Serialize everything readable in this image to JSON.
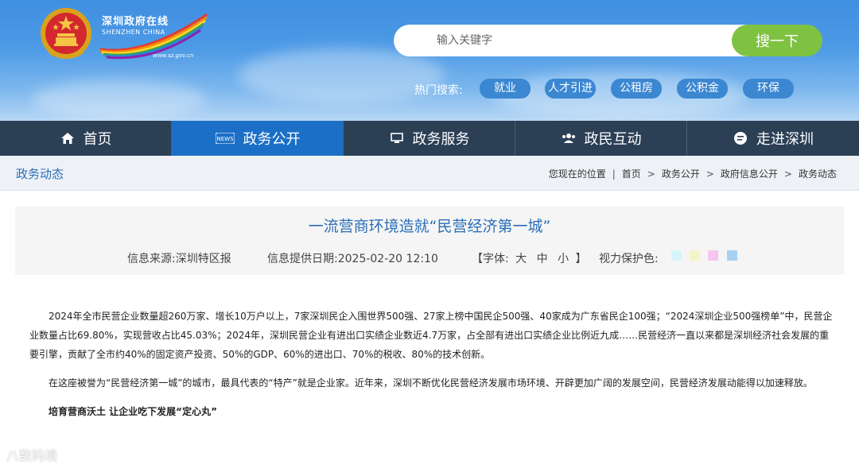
{
  "header": {
    "logo_cn": "深圳政府在线",
    "logo_en": "SHENZHEN CHINA",
    "logo_url": "www.sz.gov.cn",
    "search_placeholder": "输入关键字",
    "search_button": "搜一下",
    "hot_label": "热门搜索:",
    "hot_tags": [
      "就业",
      "人才引进",
      "公租房",
      "公积金",
      "环保"
    ]
  },
  "nav": {
    "items": [
      {
        "label": "首页",
        "icon": "home-icon"
      },
      {
        "label": "政务公开",
        "icon": "news-icon"
      },
      {
        "label": "政务服务",
        "icon": "monitor-icon"
      },
      {
        "label": "政民互动",
        "icon": "people-icon"
      },
      {
        "label": "走进深圳",
        "icon": "chat-icon"
      }
    ],
    "active_index": 1
  },
  "breadcrumb": {
    "section_title": "政务动态",
    "items": [
      "您现在的位置",
      "首页",
      "政务公开",
      "政府信息公开",
      "政务动态"
    ]
  },
  "article": {
    "title": "一流营商环境造就“民营经济第一城”",
    "source_label": "信息来源:",
    "source": "深圳特区报",
    "date_label": "信息提供日期:",
    "date": "2025-02-20 12:10",
    "font_label_open": "【字体:",
    "font_sizes": [
      "大",
      "中",
      "小"
    ],
    "font_label_close": "】",
    "eye_label": "视力保护色:",
    "eye_colors": [
      "#d6f5fb",
      "#f3f5c8",
      "#f6c6f0",
      "#a8d0f3"
    ],
    "paragraphs": [
      "2024年全市民营企业数量超260万家、增长10万户以上，7家深圳民企入围世界500强、27家上榜中国民企500强、40家成为广东省民企100强；“2024深圳企业500强榜单”中，民营企业数量占比69.80%，实现营收占比45.03%；2024年，深圳民营企业有进出口实绩企业数近4.7万家，占全部有进出口实绩企业比例近九成……民营经济一直以来都是深圳经济社会发展的重要引擎，贡献了全市约40%的固定资产投资、50%的GDP、60%的进出口、70%的税收、80%的技术创新。",
      "在这座被誉为“民营经济第一城”的城市，最具代表的“特产”就是企业家。近年来，深圳不断优化民营经济发展市场环境、开辟更加广阔的发展空间，民营经济发展动能得以加速释放。",
      "培育营商沃土 让企业吃下发展“定心丸”"
    ]
  },
  "watermark": "八数码境"
}
